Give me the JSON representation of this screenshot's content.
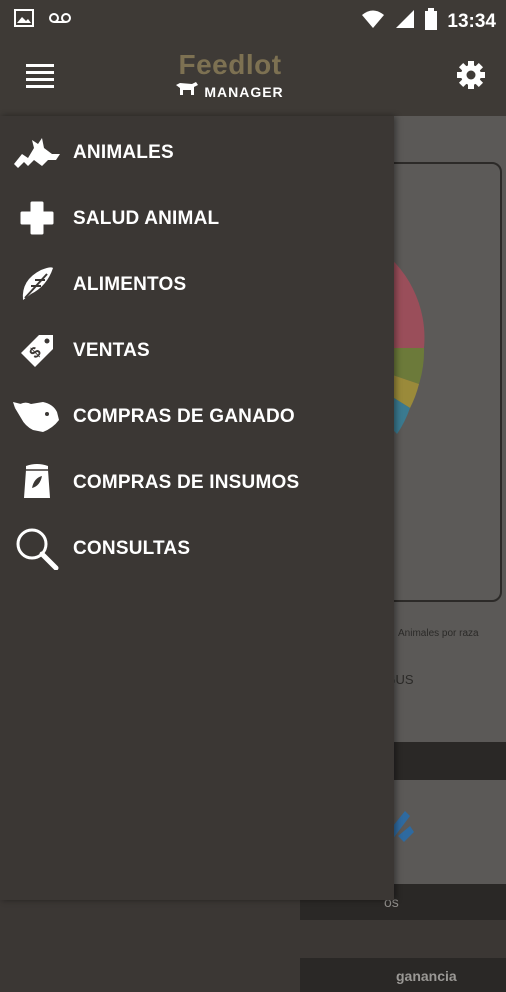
{
  "status_bar": {
    "time": "13:34",
    "icons": [
      "image-icon",
      "voicemail-icon",
      "wifi-icon",
      "signal-icon",
      "battery-icon"
    ]
  },
  "app_bar": {
    "logo_title": "Feedlot",
    "logo_subtitle": "MANAGER",
    "menu_icon": "hamburger-icon",
    "settings_icon": "gear-icon"
  },
  "drawer": {
    "items": [
      {
        "label": "ANIMALES",
        "icon": "cattle-icon"
      },
      {
        "label": "SALUD ANIMAL",
        "icon": "cross-icon"
      },
      {
        "label": "ALIMENTOS",
        "icon": "leaf-icon"
      },
      {
        "label": "VENTAS",
        "icon": "price-tag-icon"
      },
      {
        "label": "COMPRAS DE GANADO",
        "icon": "cow-head-icon"
      },
      {
        "label": "COMPRAS DE INSUMOS",
        "icon": "feed-bag-icon"
      },
      {
        "label": "CONSULTAS",
        "icon": "magnifier-icon"
      }
    ]
  },
  "background": {
    "chart_label": "Animales por raza",
    "angus_label": "NGUS",
    "strip2_label": "os",
    "strip3_label": "ganancia"
  },
  "colors": {
    "bar": "#3e3a36",
    "drawer": "#3b3734",
    "logo_accent": "#7d7152"
  }
}
